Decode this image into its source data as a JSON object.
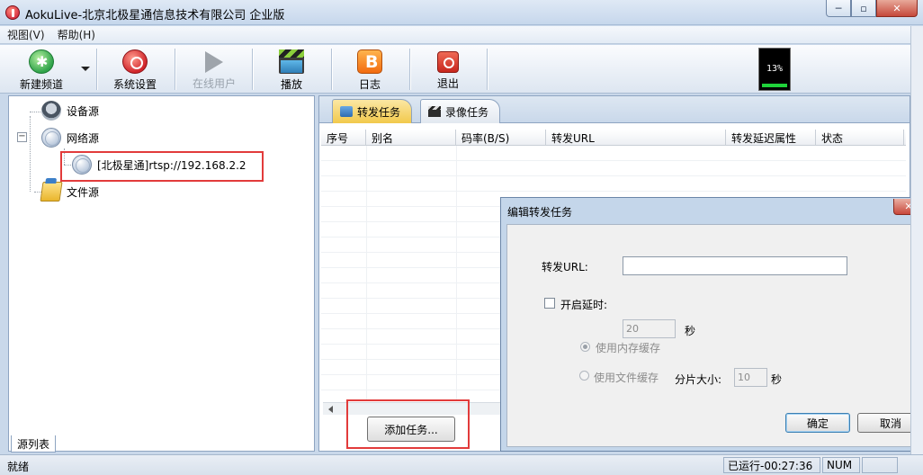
{
  "window": {
    "title": "AokuLive-北京北极星通信息技术有限公司 企业版",
    "min_glyph": "─",
    "max_glyph": "▫",
    "close_glyph": "✕"
  },
  "menu": [
    "视图(V)",
    "帮助(H)"
  ],
  "toolbar": {
    "new_channel": "新建频道",
    "settings": "系统设置",
    "online_users": "在线用户",
    "play": "播放",
    "log": "日志",
    "exit": "退出"
  },
  "cpu_meter": {
    "percent_label": "13%",
    "value": 13,
    "color": "#1fd23a"
  },
  "source_tree": {
    "device_source": "设备源",
    "network_source": "网络源",
    "network_child": "[北极星通]rtsp://192.168.2.2",
    "file_source": "文件源",
    "expander": "−"
  },
  "left_tab": "源列表",
  "tabs": {
    "forward": "转发任务",
    "record": "录像任务"
  },
  "grid": {
    "columns": [
      "序号",
      "别名",
      "码率(B/S)",
      "转发URL",
      "转发延迟属性",
      "状态"
    ]
  },
  "add_task_button": "添加任务...",
  "dialog": {
    "title": "编辑转发任务",
    "close_glyph": "✕",
    "url_label": "转发URL:",
    "url_value": "",
    "delay_checkbox_label": "开启延时:",
    "delay_value": "20",
    "delay_unit": "秒",
    "memory_cache_label": "使用内存缓存",
    "file_cache_label": "使用文件缓存",
    "slice_label": "分片大小:",
    "slice_value": "10",
    "slice_unit": "秒",
    "ok": "确定",
    "cancel": "取消"
  },
  "status": {
    "left": "就绪",
    "running": "已运行-00:27:36",
    "num": "NUM"
  },
  "colors": {
    "highlight_box": "#e23b3b",
    "active_tab": "#f2c94c"
  }
}
